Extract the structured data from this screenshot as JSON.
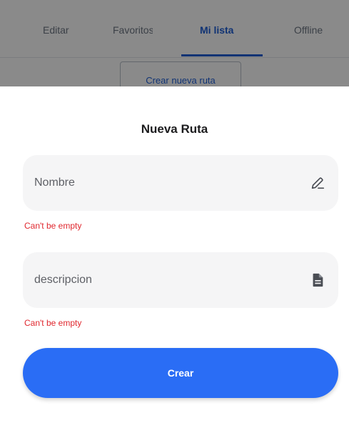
{
  "background": {
    "tabs": [
      {
        "label": "Editar",
        "active": false
      },
      {
        "label": "Favoritos",
        "active": false
      },
      {
        "label": "Mi lista",
        "active": true
      },
      {
        "label": "Offline",
        "active": false
      }
    ],
    "create_route_label": "Crear nueva ruta"
  },
  "sheet": {
    "title": "Nueva Ruta",
    "fields": [
      {
        "placeholder": "Nombre",
        "value": "",
        "icon": "edit-pencil-icon",
        "error": "Can't be empty"
      },
      {
        "placeholder": "descripcion",
        "value": "",
        "icon": "document-icon",
        "error": "Can't be empty"
      }
    ],
    "submit_label": "Crear"
  },
  "colors": {
    "accent": "#2a6df5",
    "tab_active": "#1f5fd6",
    "error": "#e0282f",
    "field_bg": "#f5f5f6"
  }
}
